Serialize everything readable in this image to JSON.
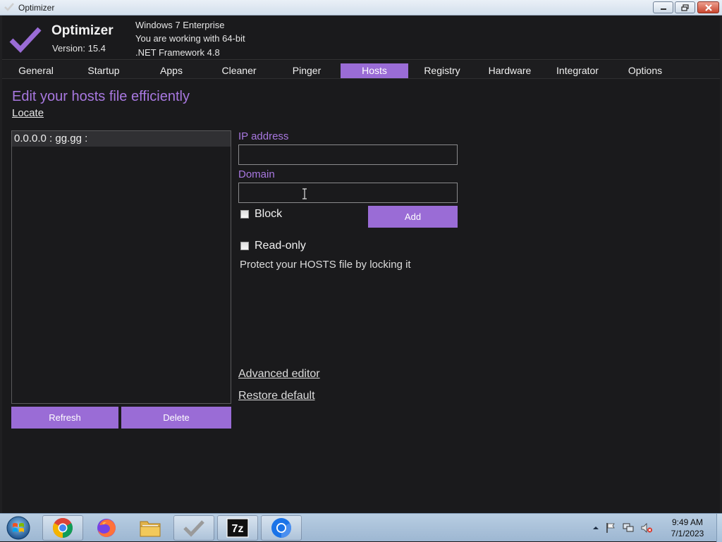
{
  "window": {
    "title": "Optimizer"
  },
  "header": {
    "app_name": "Optimizer",
    "version": "Version: 15.4",
    "os": "Windows 7 Enterprise",
    "bitness": "You are working with 64-bit",
    "framework": ".NET Framework 4.8",
    "logo_icon": "checkmark-icon"
  },
  "tabs": [
    {
      "label": "General"
    },
    {
      "label": "Startup"
    },
    {
      "label": "Apps"
    },
    {
      "label": "Cleaner"
    },
    {
      "label": "Pinger"
    },
    {
      "label": "Hosts",
      "active": true
    },
    {
      "label": "Registry"
    },
    {
      "label": "Hardware"
    },
    {
      "label": "Integrator"
    },
    {
      "label": "Options"
    }
  ],
  "hosts": {
    "title": "Edit your hosts file efficiently",
    "locate": "Locate",
    "entries": [
      "0.0.0.0 : gg.gg :"
    ],
    "refresh": "Refresh",
    "delete": "Delete",
    "ip_label": "IP address",
    "ip_value": "",
    "domain_label": "Domain",
    "domain_value": "",
    "block_label": "Block",
    "block_checked": false,
    "add": "Add",
    "readonly_label": "Read-only",
    "readonly_checked": false,
    "protect_text": "Protect your HOSTS file by locking it",
    "advanced_editor": "Advanced editor",
    "restore_default": "Restore default"
  },
  "taskbar": {
    "items": [
      "chrome-icon",
      "firefox-icon",
      "file-explorer-icon",
      "optimizer-icon",
      "7zip-icon",
      "chromium-icon"
    ],
    "sevenzip_label": "7z",
    "time": "9:49 AM",
    "date": "7/1/2023"
  },
  "colors": {
    "accent": "#9a6cd6",
    "accent_text": "#a878e0",
    "background": "#1a1a1c"
  }
}
